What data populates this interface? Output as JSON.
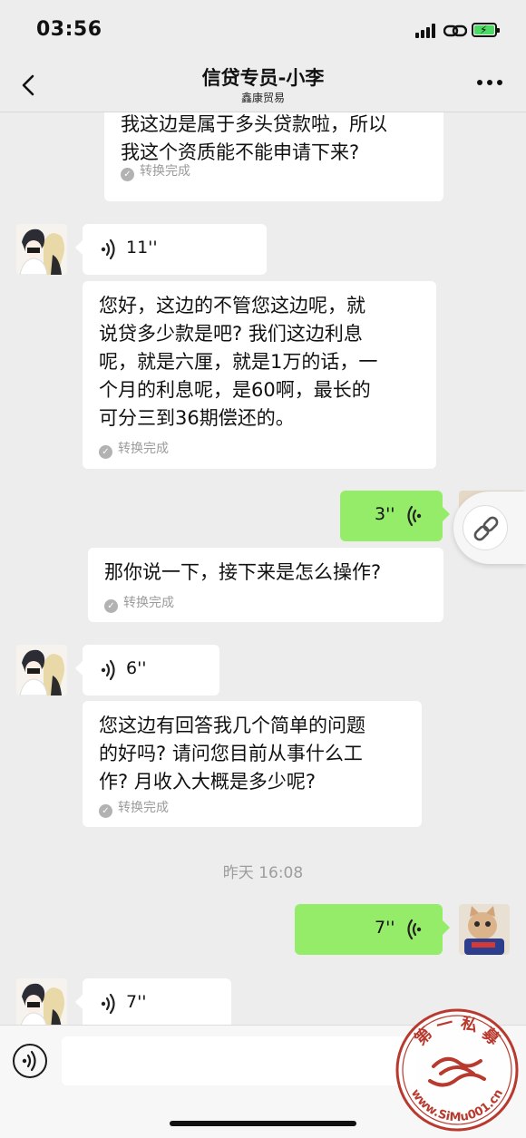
{
  "status_bar": {
    "time": "03:56"
  },
  "header": {
    "title": "信贷专员-小李",
    "subtitle": "鑫康贸易"
  },
  "messages": [
    {
      "text": "我这边是属于多头贷款啦，所以\n我这个资质能不能申请下来?",
      "status": "转换完成"
    },
    {
      "duration": "11''"
    },
    {
      "text": "您好，这边的不管您这边呢，就\n说贷多少款是吧? 我们这边利息\n呢，就是六厘，就是1万的话，一\n个月的利息呢，是60啊，最长的\n可分三到36期偿还的。",
      "status": "转换完成"
    },
    {
      "duration": "3''"
    },
    {
      "text": "那你说一下，接下来是怎么操作?",
      "status": "转换完成"
    },
    {
      "duration": "6''"
    },
    {
      "text": "您这边有回答我几个简单的问题\n的好吗? 请问您目前从事什么工\n作? 月收入大概是多少呢?",
      "status": "转换完成"
    },
    {
      "timestamp": "昨天 16:08"
    },
    {
      "duration": "7''"
    },
    {
      "duration": "7''"
    }
  ],
  "watermark": {
    "top_text": "第 一 私 募",
    "bottom_text": "www.SiMu001.cn"
  },
  "colors": {
    "background": "#ededed",
    "my_bubble": "#95ec69",
    "their_bubble": "#ffffff",
    "stamp_text": "#9d9d9d",
    "watermark": "#b83a2e"
  }
}
